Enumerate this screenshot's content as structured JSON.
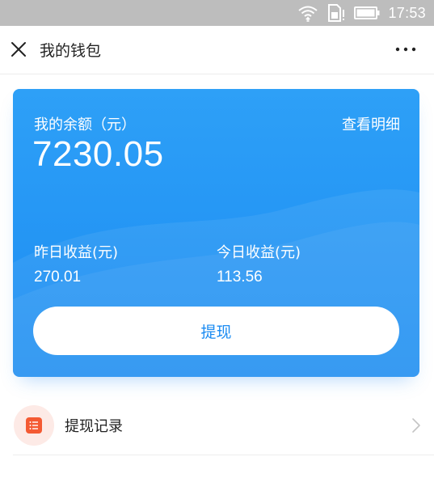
{
  "status_bar": {
    "time": "17:53",
    "icons": [
      "wifi-icon",
      "sim-alert-icon",
      "battery-icon"
    ]
  },
  "nav": {
    "title": "我的钱包",
    "close_icon": "close-icon",
    "more_icon": "more-dots-icon"
  },
  "wallet_card": {
    "balance_label": "我的余额（元）",
    "detail_link": "查看明细",
    "balance": "7230.05",
    "yesterday_label": "昨日收益(元)",
    "yesterday_value": "270.01",
    "today_label": "今日收益(元)",
    "today_value": "113.56",
    "withdraw_button": "提现"
  },
  "list": [
    {
      "label": "提现记录",
      "icon": "withdraw-record-icon"
    }
  ],
  "colors": {
    "card_blue": "#2196F3",
    "button_text_blue": "#1A8BF2",
    "record_icon_orange": "#F45A33",
    "record_icon_bg": "#FDEAE6",
    "status_bar_gray": "#BDBDBD"
  }
}
